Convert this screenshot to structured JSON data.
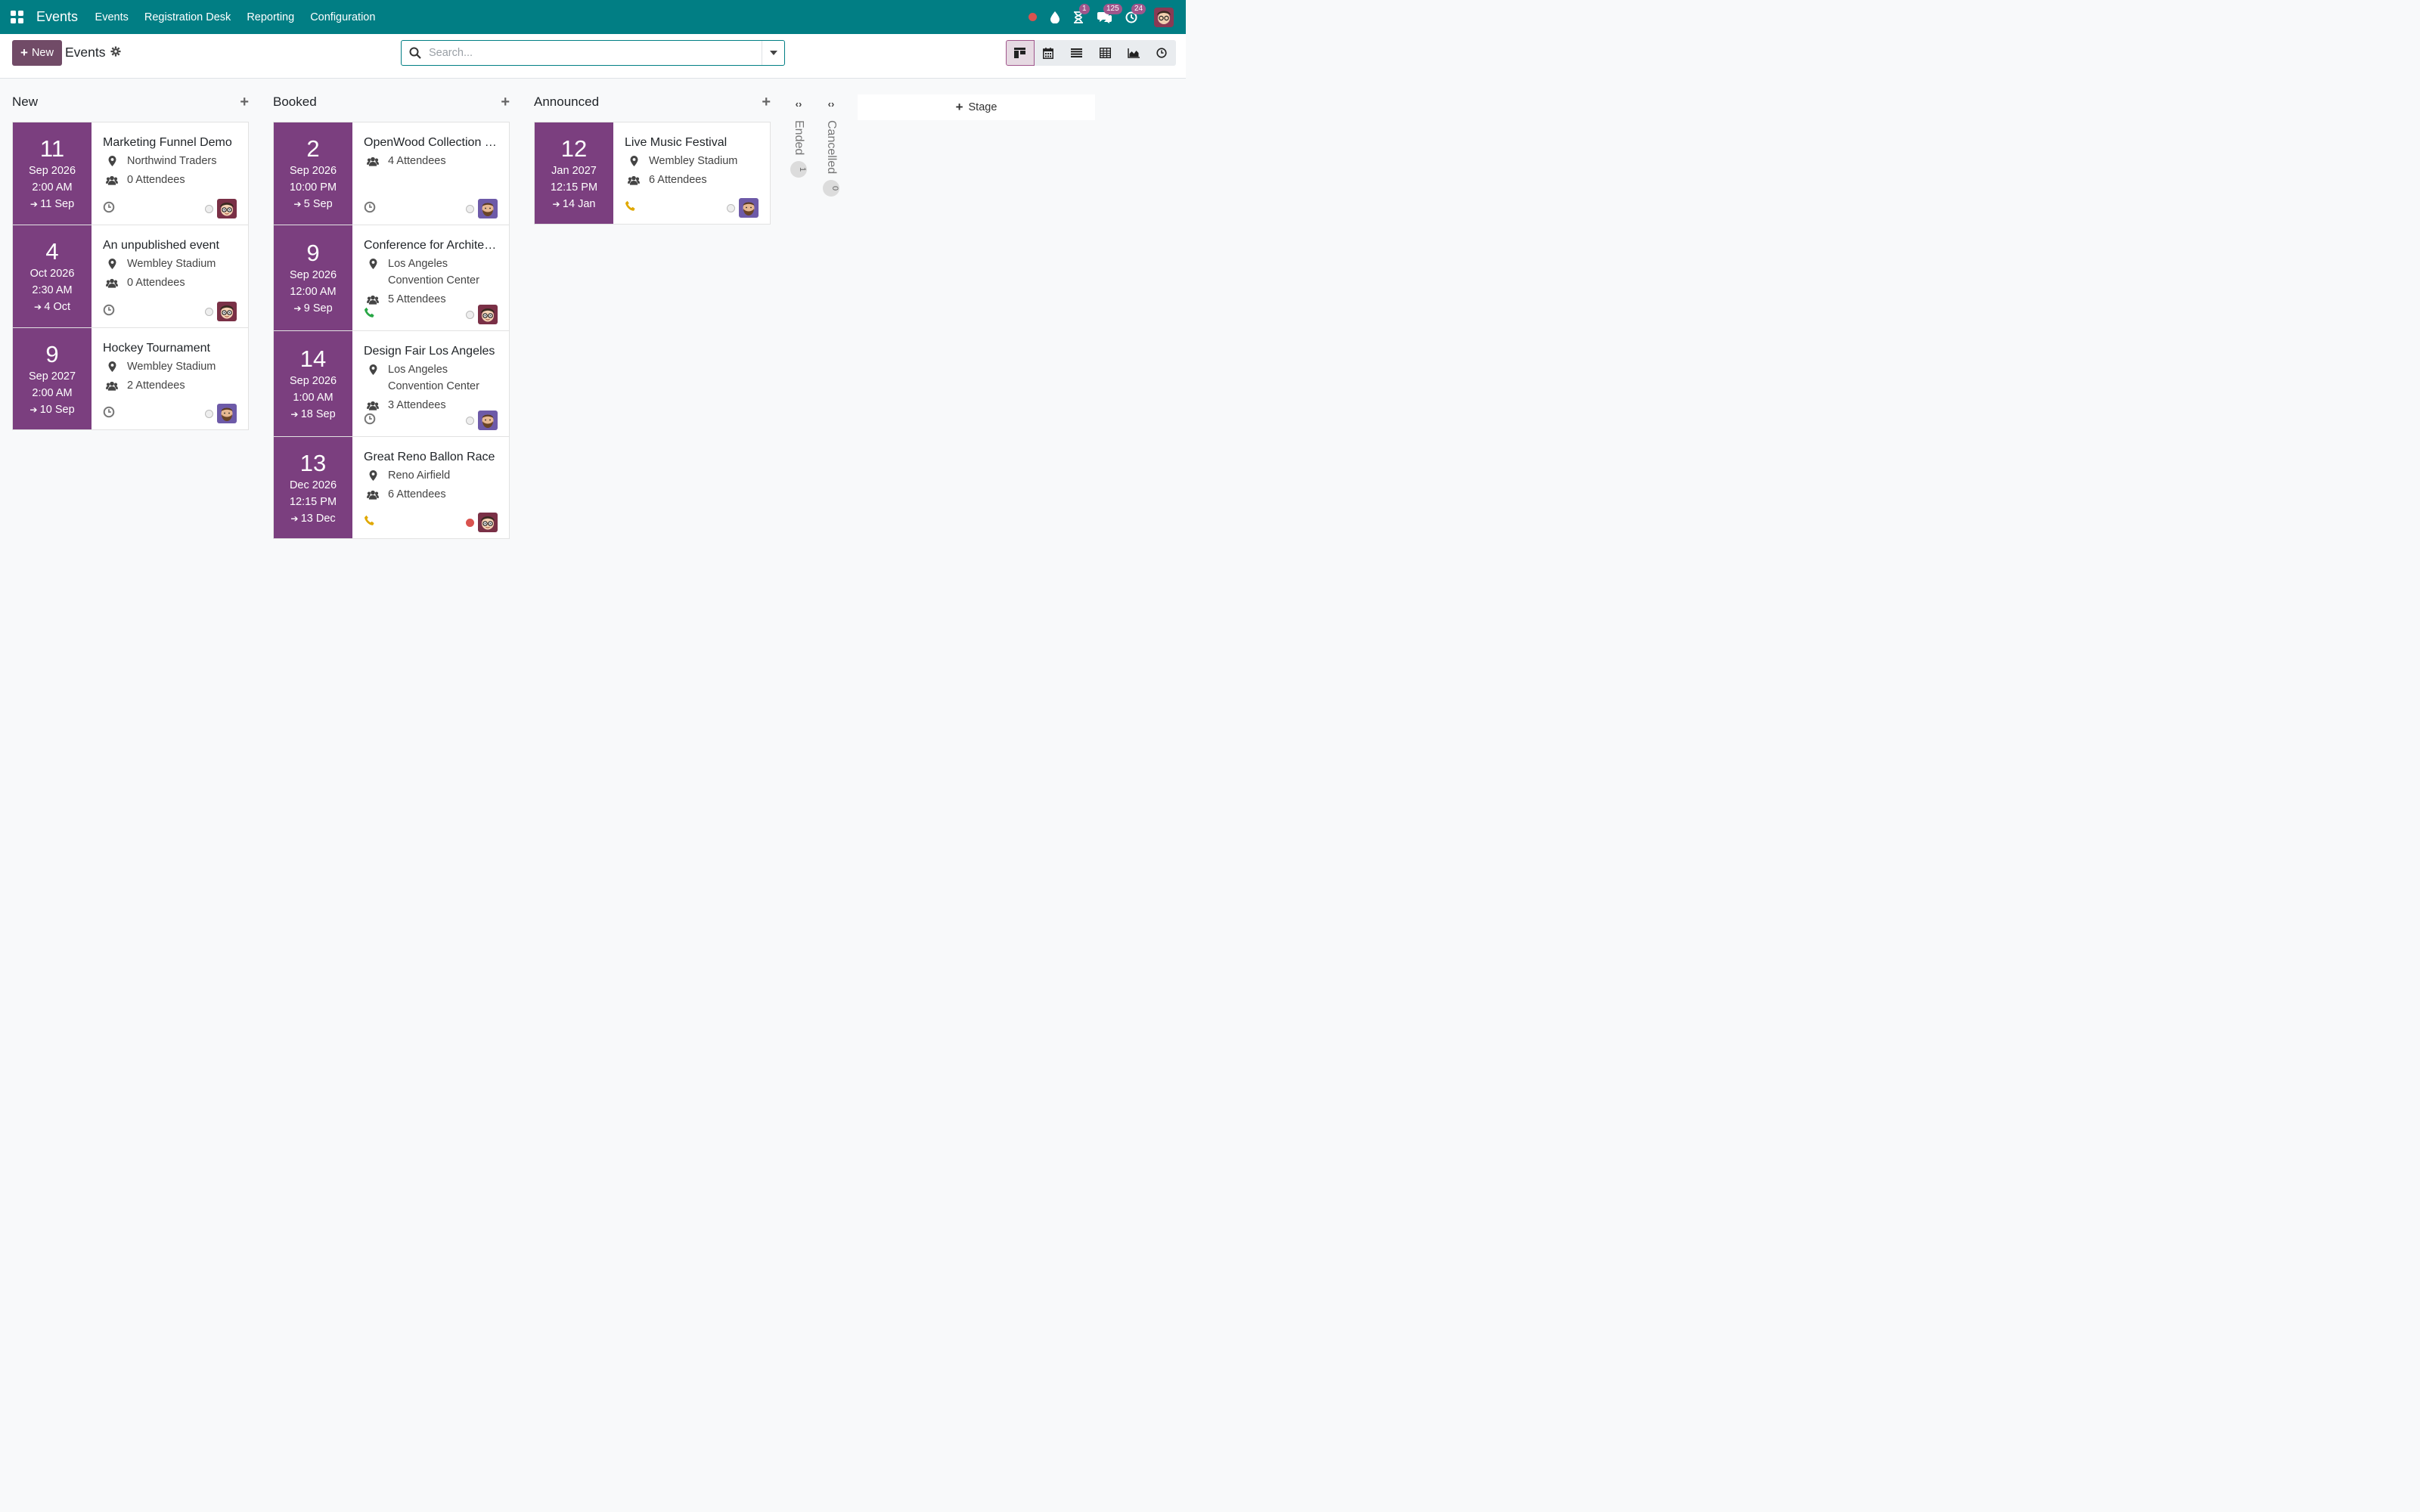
{
  "topnav": {
    "brand": "Events",
    "menu": [
      "Events",
      "Registration Desk",
      "Reporting",
      "Configuration"
    ],
    "systray": {
      "activity_badge": "1",
      "messages_badge": "125",
      "activities_badge": "24"
    }
  },
  "controlbar": {
    "new_label": "New",
    "title": "Events",
    "search_placeholder": "Search...",
    "views": [
      "kanban",
      "calendar",
      "list",
      "pivot",
      "graph",
      "activity"
    ]
  },
  "add_stage_label": "Stage",
  "columns": [
    {
      "title": "New",
      "cards": [
        {
          "day": "11",
          "month_year": "Sep 2026",
          "time": "2:00 AM",
          "end": "11 Sep",
          "title": "Marketing Funnel Demo",
          "location": [
            "Northwind Traders"
          ],
          "attendees": "0 Attendees",
          "activity": "clock-icon",
          "status": "none",
          "avatar": "glasses"
        },
        {
          "day": "4",
          "month_year": "Oct 2026",
          "time": "2:30 AM",
          "end": "4 Oct",
          "title": "An unpublished event",
          "location": [
            "Wembley Stadium"
          ],
          "attendees": "0 Attendees",
          "activity": "clock-icon",
          "status": "none",
          "avatar": "glasses"
        },
        {
          "day": "9",
          "month_year": "Sep 2027",
          "time": "2:00 AM",
          "end": "10 Sep",
          "title": "Hockey Tournament",
          "location": [
            "Wembley Stadium"
          ],
          "attendees": "2 Attendees",
          "activity": "clock-icon",
          "status": "none",
          "avatar": "beard"
        }
      ]
    },
    {
      "title": "Booked",
      "cards": [
        {
          "day": "2",
          "month_year": "Sep 2026",
          "time": "10:00 PM",
          "end": "5 Sep",
          "title": "OpenWood Collection Online Reveal",
          "location": [],
          "attendees": "4 Attendees",
          "activity": "clock-icon",
          "status": "none",
          "avatar": "beard"
        },
        {
          "day": "9",
          "month_year": "Sep 2026",
          "time": "12:00 AM",
          "end": "9 Sep",
          "title": "Conference for Architects",
          "location": [
            "Los Angeles",
            "Convention Center"
          ],
          "attendees": "5 Attendees",
          "activity": "phone-green-icon",
          "status": "none",
          "avatar": "glasses"
        },
        {
          "day": "14",
          "month_year": "Sep 2026",
          "time": "1:00 AM",
          "end": "18 Sep",
          "title": "Design Fair Los Angeles",
          "location": [
            "Los Angeles",
            "Convention Center"
          ],
          "attendees": "3 Attendees",
          "activity": "clock-icon",
          "status": "none",
          "avatar": "beard"
        },
        {
          "day": "13",
          "month_year": "Dec 2026",
          "time": "12:15 PM",
          "end": "13 Dec",
          "title": "Great Reno Ballon Race",
          "location": [
            "Reno Airfield"
          ],
          "attendees": "6 Attendees",
          "activity": "phone-orange-icon",
          "status": "red",
          "avatar": "glasses"
        }
      ]
    },
    {
      "title": "Announced",
      "cards": [
        {
          "day": "12",
          "month_year": "Jan 2027",
          "time": "12:15 PM",
          "end": "14 Jan",
          "title": "Live Music Festival",
          "location": [
            "Wembley Stadium"
          ],
          "attendees": "6 Attendees",
          "activity": "phone-orange-icon",
          "status": "none",
          "avatar": "beard"
        }
      ]
    }
  ],
  "folded": [
    {
      "title": "Ended",
      "count": "1"
    },
    {
      "title": "Cancelled",
      "count": "0"
    }
  ],
  "colors": {
    "navbar": "#017e84",
    "primary": "#714b67",
    "date_box": "#7b3f7f"
  }
}
